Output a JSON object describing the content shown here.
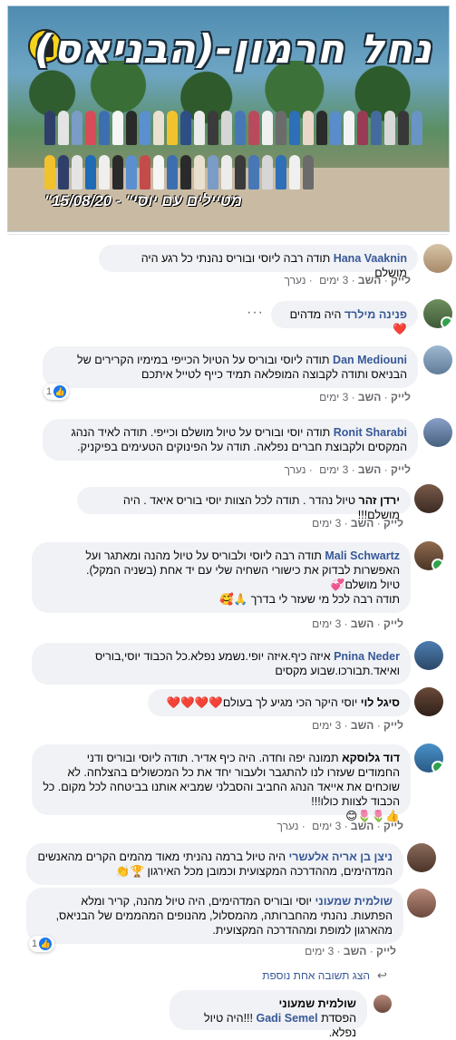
{
  "banner": {
    "title": "נחל חרמון-(הבניאס)",
    "subtitle": "\"מטיילים עם יוסי\" - 15/08/20"
  },
  "labels": {
    "like": "לייק",
    "reply": "השב",
    "edited": "נערך"
  },
  "comments": [
    {
      "name": "Hana Vaaknin",
      "text": "תודה רבה ליוסי ובוריס נהנתי כל רגע היה מושלם",
      "time": "3 ימים",
      "edited": true
    },
    {
      "name": "פנינה מילרד",
      "text": "היה מדהים ❤️",
      "time": "",
      "edited": false
    },
    {
      "name": "Dan Mediouni",
      "text": "תודה ליוסי ובוריס על הטיול הכייפי במימיו הקרירים של הבניאס ותודה לקבוצה המופלאה תמיד כייף לטייל איתכם",
      "time": "3 ימים",
      "edited": false,
      "reactions": "1"
    },
    {
      "name": "Ronit Sharabi",
      "text": "תודה יוסי ובוריס על טיול מושלם וכייפי. תודה לאיד הנהג המקסים ולקבוצת חברים נפלאה. תודה על הפינוקים הטעימים בפיקניק.",
      "time": "3 ימים",
      "edited": true
    },
    {
      "name": "ירדן זהר",
      "text": "טיול נהדר . תודה לכל הצוות יוסי בוריס איאד . היה מושלם!!!",
      "time": "3 ימים",
      "edited": false
    },
    {
      "name": "Mali Schwartz",
      "text": "תודה רבה ליוסי ולבוריס על טיול מהנה ומאתגר ועל האפשרות לבדוק את כישורי השחיה שלי עם יד אחת (בשניה המקל).",
      "text2": "טיול מושלם💞",
      "text3": "תודה רבה לכל מי שעזר לי בדרך 🙏🥰",
      "time": "3 ימים",
      "edited": false
    },
    {
      "name": "Pnina Neder",
      "text": "איזה כיף.איזה יופי.נשמע נפלא.כל הכבוד יוסי,בוריס ואיאד.תבורכו.שבוע מקסים",
      "time": "3 ימים",
      "edited": false
    },
    {
      "name": "סיגל לוי",
      "text": "יוסי היקר הכי מגיע לך בעולם❤️❤️❤️❤️",
      "time": "3 ימים",
      "edited": false
    },
    {
      "name": "דוד גלוסקא",
      "text": "תמונה יפה וחדה. היה כיף אדיר. תודה ליוסי ובוריס ודני החמודים שעזרו לנו להתגבר ולעבור יחד את כל המכשולים בהצלחה. לא שוכחים את אייאד הנהג החביב והסבלני שמביא אותנו בביטחה לכל מקום. כל הכבוד לצוות כולו!!!",
      "text2": "👍🌷🌷😊",
      "time": "3 ימים",
      "edited": true
    },
    {
      "name": "ניצן בן אריה אלעשרי",
      "text": "היה טיול ברמה נהניתי מאוד מהמים הקרים מהאנשים המדהימים, מההדרכה המקצועית וכמובן מכל האירגון 🏆👏",
      "time": "",
      "edited": false
    },
    {
      "name": "שולמית שמעוני",
      "text": "יוסי ובוריס המדהימים, היה טיול מהנה, קריר ומלא הפתעות. נהנתי מהחברותה, מהמסלול, מהנופים המהממים של הבניאס, מהארגון למופת ומההדרכה המקצועית.",
      "time": "3 ימים",
      "edited": false,
      "reactions": "1"
    }
  ],
  "reply_link": "הצג תשובה אחת נוספת",
  "reply": {
    "name": "שולמית שמעוני",
    "tag": "Gadi Semel",
    "text": "הפסדת",
    "text2": "!!!היה טיול נפלא."
  }
}
